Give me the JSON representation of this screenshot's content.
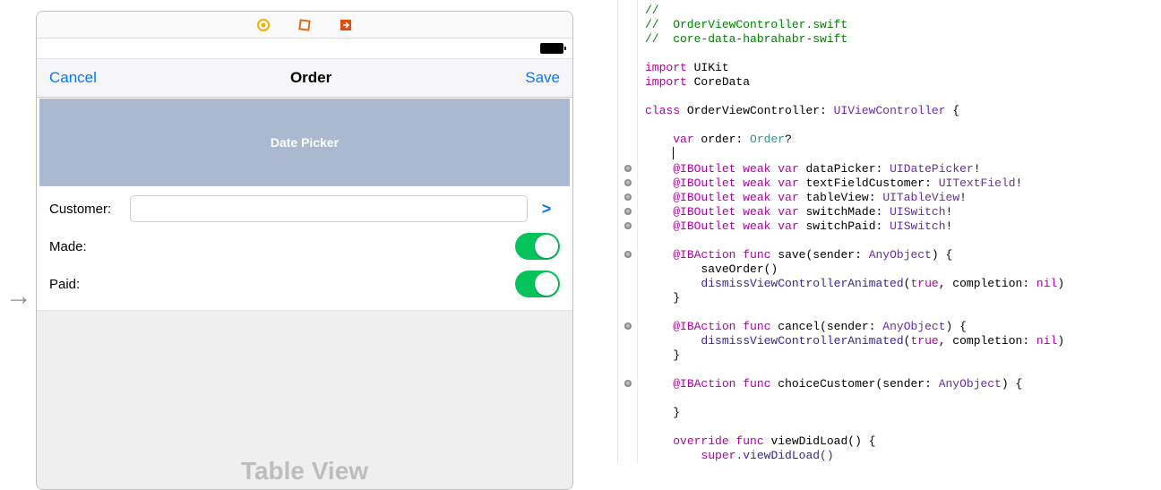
{
  "ib": {
    "dock_icons": [
      "circle-icon",
      "box-icon",
      "exit-icon"
    ],
    "nav": {
      "cancel": "Cancel",
      "title": "Order",
      "save": "Save"
    },
    "datepicker_label": "Date Picker",
    "form": {
      "customer_label": "Customer:",
      "customer_value": "",
      "made_label": "Made:",
      "paid_label": "Paid:"
    },
    "tableview_label": "Table View",
    "chevron": ">"
  },
  "code": {
    "lines": [
      {
        "t": "comment",
        "txt": "//"
      },
      {
        "t": "comment",
        "txt": "//  OrderViewController.swift"
      },
      {
        "t": "comment",
        "txt": "//  core-data-habrahabr-swift"
      },
      {
        "t": "blank",
        "txt": ""
      },
      {
        "t": "import",
        "kw": "import",
        "mod": "UIKit"
      },
      {
        "t": "import",
        "kw": "import",
        "mod": "CoreData"
      },
      {
        "t": "blank",
        "txt": ""
      },
      {
        "t": "class",
        "kw": "class",
        "name": "OrderViewController",
        "sup": "UIViewController",
        "tail": " {"
      },
      {
        "t": "blank",
        "txt": ""
      },
      {
        "t": "var",
        "indent": 4,
        "kw": "var",
        "name": "order",
        "type": "Order",
        "suffix": "?"
      },
      {
        "t": "cursor",
        "indent": 4
      },
      {
        "t": "outlet",
        "indent": 4,
        "name": "dataPicker",
        "type": "UIDatePicker",
        "mark": true
      },
      {
        "t": "outlet",
        "indent": 4,
        "name": "textFieldCustomer",
        "type": "UITextField",
        "mark": true
      },
      {
        "t": "outlet",
        "indent": 4,
        "name": "tableView",
        "type": "UITableView",
        "mark": true
      },
      {
        "t": "outlet",
        "indent": 4,
        "name": "switchMade",
        "type": "UISwitch",
        "mark": true
      },
      {
        "t": "outlet",
        "indent": 4,
        "name": "switchPaid",
        "type": "UISwitch",
        "mark": true
      },
      {
        "t": "blank",
        "txt": ""
      },
      {
        "t": "action",
        "indent": 4,
        "name": "save",
        "param": "sender",
        "ptype": "AnyObject",
        "tail": " {",
        "mark": true
      },
      {
        "t": "call1",
        "indent": 8,
        "txt": "saveOrder()"
      },
      {
        "t": "dismiss",
        "indent": 8
      },
      {
        "t": "raw",
        "indent": 4,
        "txt": "}"
      },
      {
        "t": "blank",
        "txt": ""
      },
      {
        "t": "action",
        "indent": 4,
        "name": "cancel",
        "param": "sender",
        "ptype": "AnyObject",
        "tail": " {",
        "mark": true
      },
      {
        "t": "dismiss",
        "indent": 8
      },
      {
        "t": "raw",
        "indent": 4,
        "txt": "}"
      },
      {
        "t": "blank",
        "txt": ""
      },
      {
        "t": "action",
        "indent": 4,
        "name": "choiceCustomer",
        "param": "sender",
        "ptype": "AnyObject",
        "tail": " {",
        "mark": true
      },
      {
        "t": "blank",
        "txt": ""
      },
      {
        "t": "raw",
        "indent": 4,
        "txt": "}"
      },
      {
        "t": "blank",
        "txt": ""
      },
      {
        "t": "override",
        "indent": 4,
        "kw1": "override",
        "kw2": "func",
        "name": "viewDidLoad",
        "tail": "() {"
      },
      {
        "t": "super",
        "indent": 8,
        "txt": "super",
        "call": ".viewDidLoad()"
      }
    ],
    "outlet_kw": "@IBOutlet",
    "action_kw": "@IBAction",
    "weak_kw": "weak",
    "var_kw": "var",
    "func_kw": "func",
    "dismiss": {
      "fn": "dismissViewControllerAnimated",
      "arg1": "true",
      "arg2label": "completion",
      "arg2": "nil"
    }
  }
}
